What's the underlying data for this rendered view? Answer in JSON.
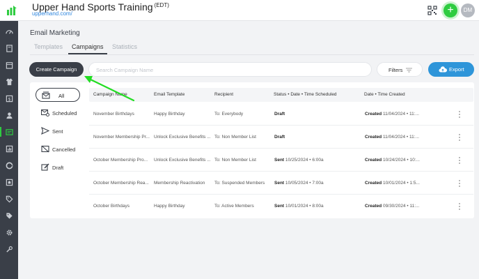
{
  "header": {
    "title": "Upper Hand Sports Training",
    "timezone": "(EDT)",
    "url": "upperhand.com/",
    "avatar_initials": "DM",
    "add_label": "+"
  },
  "page": {
    "title": "Email Marketing",
    "tabs": [
      {
        "label": "Templates",
        "active": false
      },
      {
        "label": "Campaigns",
        "active": true
      },
      {
        "label": "Statistics",
        "active": false
      }
    ]
  },
  "toolbar": {
    "create_label": "Create Campaign",
    "search_placeholder": "Search Campaign Name",
    "filters_label": "Filters",
    "export_label": "Export"
  },
  "folders": [
    {
      "label": "All",
      "icon": "mail-stack-icon",
      "active": true
    },
    {
      "label": "Scheduled",
      "icon": "mail-clock-icon",
      "active": false
    },
    {
      "label": "Sent",
      "icon": "send-icon",
      "active": false
    },
    {
      "label": "Cancelled",
      "icon": "mail-cancel-icon",
      "active": false
    },
    {
      "label": "Draft",
      "icon": "edit-icon",
      "active": false
    }
  ],
  "table": {
    "columns": [
      "Campaign Name",
      "Email Template",
      "Recipient",
      "Status • Date • Time Scheduled",
      "Date • Time Created"
    ],
    "rows": [
      {
        "name": "November Birthdays",
        "template": "Happy Birthday",
        "recipient": "To: Everybody",
        "status": "Draft",
        "scheduled": "",
        "created_label": "Created",
        "created": "11/04/2024 • 11:..."
      },
      {
        "name": "November Membership Pr...",
        "template": "Unlock Exclusive Benefits ...",
        "recipient": "To: Non Member List",
        "status": "Draft",
        "scheduled": "",
        "created_label": "Created",
        "created": "11/04/2024 • 11:..."
      },
      {
        "name": "October Membership Pro...",
        "template": "Unlock Exclusive Benefits ...",
        "recipient": "To: Non Member List",
        "status": "Sent",
        "scheduled": "10/25/2024 • 6:00a",
        "created_label": "Created",
        "created": "10/24/2024 • 10:..."
      },
      {
        "name": "October Membership Rea...",
        "template": "Membership Reactivation",
        "recipient": "To: Suspended Members",
        "status": "Sent",
        "scheduled": "10/05/2024 • 7:00a",
        "created_label": "Created",
        "created": "10/01/2024 • 1:5..."
      },
      {
        "name": "October Birthdays",
        "template": "Happy Birthday",
        "recipient": "To: Active Members",
        "status": "Sent",
        "scheduled": "10/01/2024 • 8:00a",
        "created_label": "Created",
        "created": "09/30/2024 • 11:..."
      }
    ]
  },
  "sidebar_icons": [
    "dashboard-icon",
    "book-icon",
    "calendar-icon",
    "jersey-icon",
    "dollar-icon",
    "users-icon",
    "email-icon",
    "reports-icon",
    "gauge-icon",
    "ticket-icon",
    "tag-icon",
    "tags-icon",
    "settings-icon",
    "tools-icon"
  ],
  "colors": {
    "sidebar": "#3a3f48",
    "accent_green": "#2ecc40",
    "export_blue": "#2e95d9",
    "link_blue": "#2e86de",
    "annotation_arrow": "#22dd22"
  }
}
